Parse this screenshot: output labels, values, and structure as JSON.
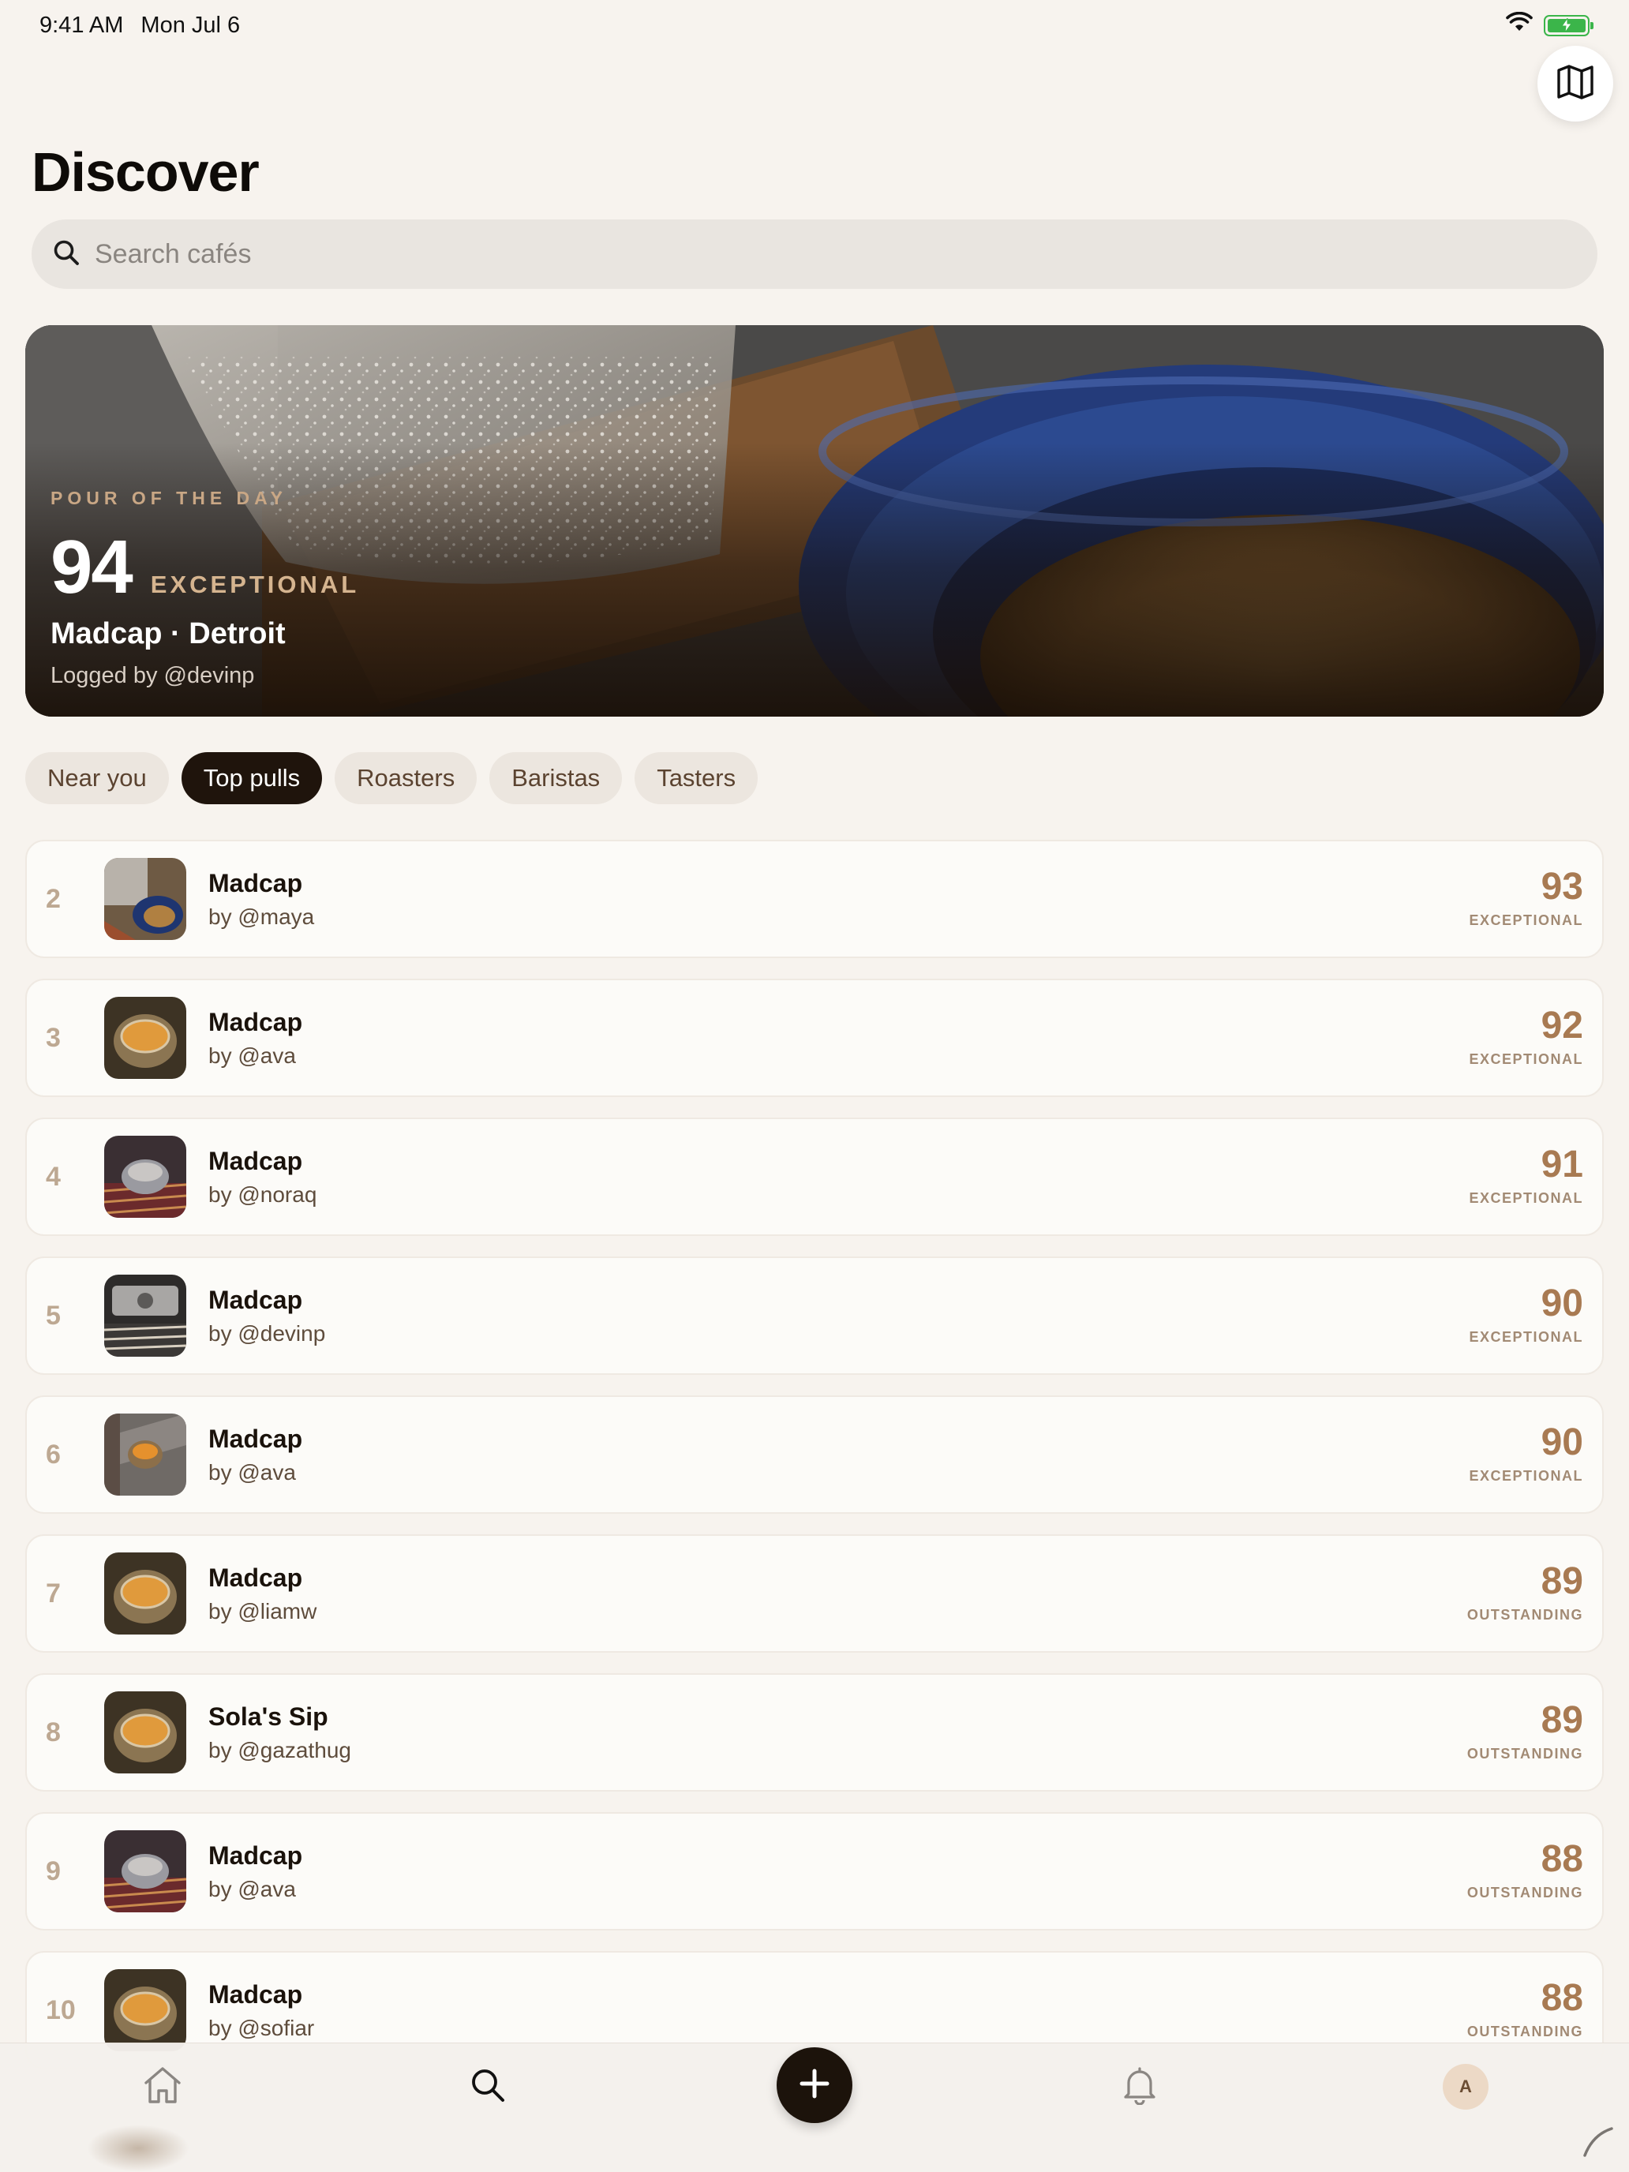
{
  "status_bar": {
    "time": "9:41 AM",
    "date": "Mon Jul 6"
  },
  "header": {
    "title": "Discover",
    "map_icon": "map-icon"
  },
  "search": {
    "placeholder": "Search cafés"
  },
  "hero": {
    "eyebrow": "POUR OF THE DAY",
    "score": "94",
    "rating": "EXCEPTIONAL",
    "name": "Madcap · Detroit",
    "logged_by": "Logged by @devinp"
  },
  "filters": [
    {
      "label": "Near you",
      "active": false
    },
    {
      "label": "Top pulls",
      "active": true
    },
    {
      "label": "Roasters",
      "active": false
    },
    {
      "label": "Baristas",
      "active": false
    },
    {
      "label": "Tasters",
      "active": false
    }
  ],
  "rankings": [
    {
      "rank": "2",
      "name": "Madcap",
      "by": "by @maya",
      "score": "93",
      "rating": "EXCEPTIONAL",
      "thumb": "blue-cup"
    },
    {
      "rank": "3",
      "name": "Madcap",
      "by": "by @ava",
      "score": "92",
      "rating": "EXCEPTIONAL",
      "thumb": "glass-cup"
    },
    {
      "rank": "4",
      "name": "Madcap",
      "by": "by @noraq",
      "score": "91",
      "rating": "EXCEPTIONAL",
      "thumb": "glass-rug"
    },
    {
      "rank": "5",
      "name": "Madcap",
      "by": "by @devinp",
      "score": "90",
      "rating": "EXCEPTIONAL",
      "thumb": "machine"
    },
    {
      "rank": "6",
      "name": "Madcap",
      "by": "by @ava",
      "score": "90",
      "rating": "EXCEPTIONAL",
      "thumb": "glass-stone"
    },
    {
      "rank": "7",
      "name": "Madcap",
      "by": "by @liamw",
      "score": "89",
      "rating": "OUTSTANDING",
      "thumb": "glass-cup"
    },
    {
      "rank": "8",
      "name": "Sola's Sip",
      "by": "by @gazathug",
      "score": "89",
      "rating": "OUTSTANDING",
      "thumb": "glass-cup"
    },
    {
      "rank": "9",
      "name": "Madcap",
      "by": "by @ava",
      "score": "88",
      "rating": "OUTSTANDING",
      "thumb": "glass-rug"
    },
    {
      "rank": "10",
      "name": "Madcap",
      "by": "by @sofiar",
      "score": "88",
      "rating": "OUTSTANDING",
      "thumb": "glass-cup"
    }
  ],
  "tab_bar": {
    "tabs": [
      "home-icon",
      "search-icon",
      "add-icon",
      "bell-icon",
      "profile-avatar"
    ],
    "avatar_initial": "A"
  },
  "colors": {
    "accent": "#a87a52",
    "background": "#f7f3ee",
    "dark": "#1f140c"
  }
}
